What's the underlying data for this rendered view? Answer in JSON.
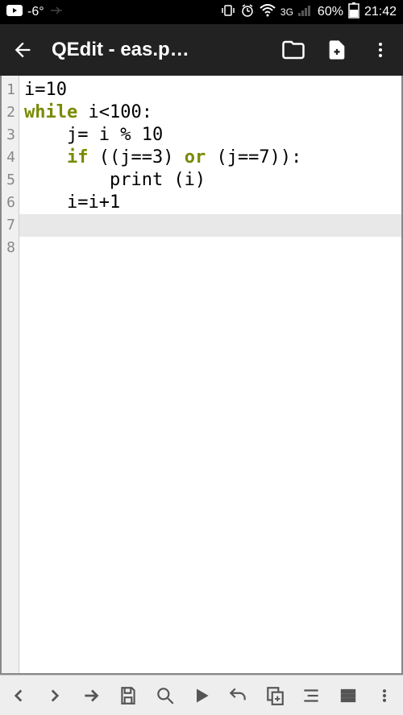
{
  "status": {
    "temp": "-6°",
    "network": "3G",
    "battery": "60%",
    "time": "21:42"
  },
  "appbar": {
    "title": "QEdit - eas.p…"
  },
  "code": {
    "lines": [
      {
        "n": 1,
        "segs": [
          {
            "t": "i=10"
          }
        ]
      },
      {
        "n": 2,
        "segs": [
          {
            "t": "while",
            "c": "kw"
          },
          {
            "t": " i<100:"
          }
        ]
      },
      {
        "n": 3,
        "segs": [
          {
            "t": "    j= i % 10"
          }
        ]
      },
      {
        "n": 4,
        "segs": [
          {
            "t": "    "
          },
          {
            "t": "if",
            "c": "kw"
          },
          {
            "t": " ((j==3) "
          },
          {
            "t": "or",
            "c": "kw"
          },
          {
            "t": " (j==7)):"
          }
        ]
      },
      {
        "n": 5,
        "segs": [
          {
            "t": "        print (i)"
          }
        ]
      },
      {
        "n": 6,
        "segs": [
          {
            "t": "    i=i+1"
          }
        ]
      },
      {
        "n": 7,
        "segs": [],
        "hl": true
      },
      {
        "n": 8,
        "segs": []
      }
    ]
  }
}
